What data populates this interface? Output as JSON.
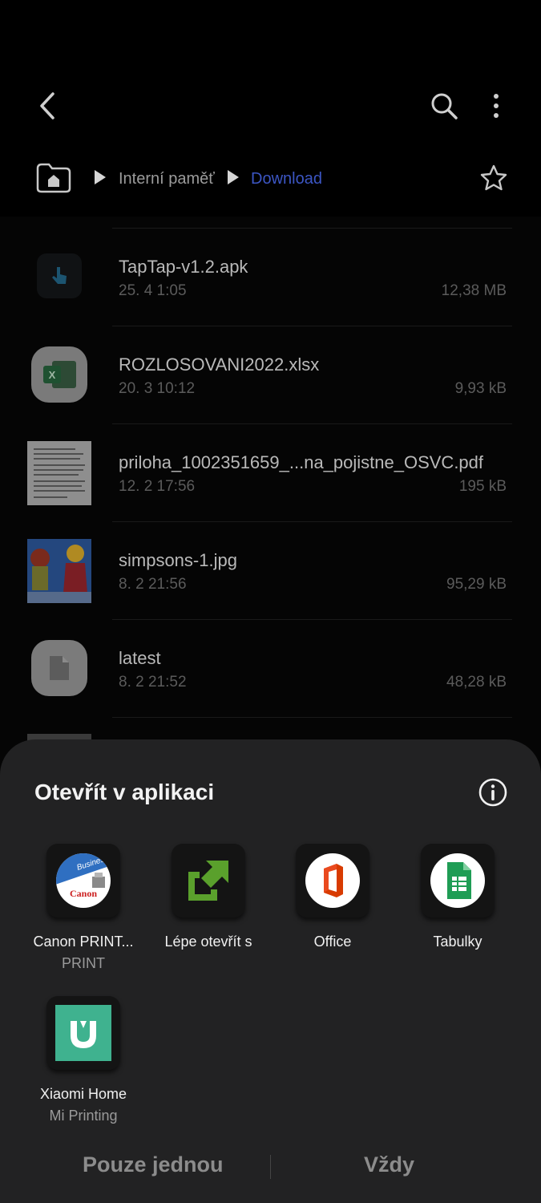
{
  "file_manager": {
    "breadcrumb": [
      "Interní paměť",
      "Download"
    ],
    "files": [
      {
        "name": "TapTap-v1.2.apk",
        "date": "25. 4 1:05",
        "size": "12,38 MB",
        "icon": "apk-icon"
      },
      {
        "name": "ROZLOSOVANI2022.xlsx",
        "date": "20. 3 10:12",
        "size": "9,93 kB",
        "icon": "excel-icon"
      },
      {
        "name": "priloha_1002351659_...na_pojistne_OSVC.pdf",
        "date": "12. 2 17:56",
        "size": "195 kB",
        "icon": "pdf-thumbnail"
      },
      {
        "name": "simpsons-1.jpg",
        "date": "8. 2 21:56",
        "size": "95,29 kB",
        "icon": "image-thumbnail"
      },
      {
        "name": "latest",
        "date": "8. 2 21:52",
        "size": "48,28 kB",
        "icon": "file-icon"
      }
    ]
  },
  "sheet": {
    "title": "Otevřít v aplikaci",
    "apps": [
      {
        "label": "Canon PRINT...",
        "sub": "PRINT",
        "icon": "canon-print-icon"
      },
      {
        "label": "Lépe otevřít s",
        "sub": "",
        "icon": "open-with-icon"
      },
      {
        "label": "Office",
        "sub": "",
        "icon": "office-icon"
      },
      {
        "label": "Tabulky",
        "sub": "",
        "icon": "sheets-icon"
      },
      {
        "label": "Xiaomi Home",
        "sub": "Mi Printing",
        "icon": "xiaomi-home-icon"
      }
    ],
    "canon_badge": "Business",
    "canon_logo": "Canon",
    "just_once": "Pouze jednou",
    "always": "Vždy"
  },
  "colors": {
    "accent_blue": "#3c56c4",
    "sheet_bg": "#222223",
    "sheets_green": "#1f9d55",
    "office_red": "#d83b01",
    "xiaomi_teal": "#3fb28f",
    "open_with_green": "#5aa02c"
  }
}
